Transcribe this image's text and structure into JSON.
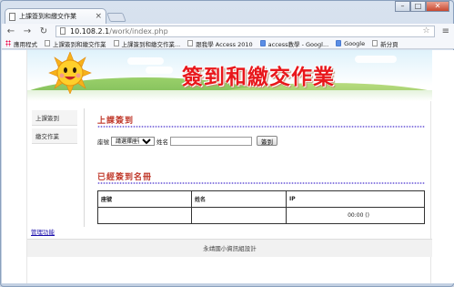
{
  "browser": {
    "tab_title": "上課簽到和繳交作業",
    "url_host": "10.108.2.1",
    "url_path": "/work/index.php",
    "bookmarks": [
      {
        "label": "應用程式",
        "icon": "apps-icon"
      },
      {
        "label": "上課簽到和繳交作業",
        "icon": "page-icon"
      },
      {
        "label": "上課簽到和繳交作業...",
        "icon": "page-icon"
      },
      {
        "label": "跟我學 Access 2010",
        "icon": "page-icon"
      },
      {
        "label": "access教學 - Googl...",
        "icon": "google-icon"
      },
      {
        "label": "Google",
        "icon": "google-icon"
      },
      {
        "label": "新分頁",
        "icon": "page-icon"
      }
    ]
  },
  "banner": {
    "title": "簽到和繳交作業"
  },
  "sidebar": {
    "items": [
      {
        "label": "上課簽到"
      },
      {
        "label": "繳交作業"
      }
    ]
  },
  "signin": {
    "heading": "上課簽到",
    "seat_label": "座號",
    "seat_select": "請選擇座號",
    "name_label": "姓名",
    "name_value": "",
    "submit_label": "簽到"
  },
  "signed": {
    "heading": "已經簽到名冊",
    "columns": [
      "座號",
      "姓名",
      "IP"
    ],
    "rows": [
      [
        "",
        "",
        "00:00 ()"
      ]
    ]
  },
  "admin_link": "管理功能",
  "footer": "永靖國小資訊組設計",
  "colors": {
    "title_red": "#e8171b",
    "heading_red": "#c0392b",
    "dot_purple": "#8a7ce0"
  }
}
